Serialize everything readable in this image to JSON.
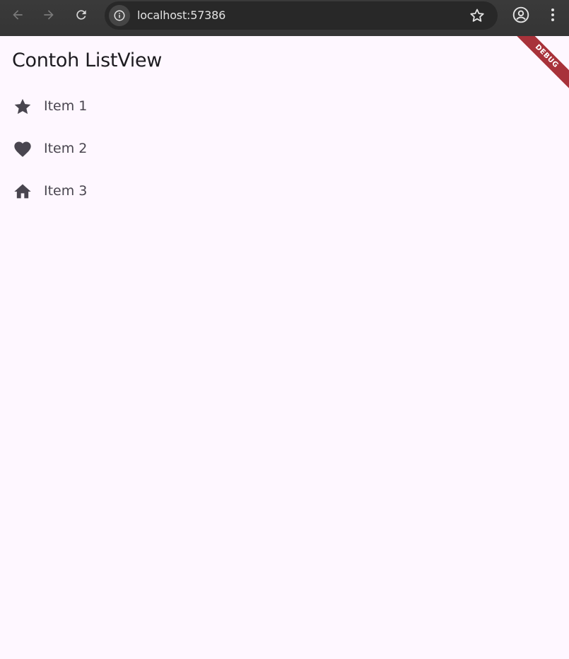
{
  "browser": {
    "url": "localhost:57386",
    "back_icon": "arrow-left-icon",
    "forward_icon": "arrow-right-icon",
    "reload_icon": "reload-icon",
    "info_icon": "info-icon",
    "bookmark_icon": "star-outline-icon",
    "profile_icon": "profile-icon",
    "menu_icon": "kebab-menu-icon"
  },
  "app": {
    "title": "Contoh ListView",
    "debug_banner": "DEBUG",
    "items": [
      {
        "label": "Item 1",
        "icon": "star-icon"
      },
      {
        "label": "Item 2",
        "icon": "heart-icon"
      },
      {
        "label": "Item 3",
        "icon": "home-icon"
      }
    ]
  },
  "colors": {
    "background": "#fef7ff",
    "icon": "#49454f",
    "banner": "#a8323a"
  }
}
